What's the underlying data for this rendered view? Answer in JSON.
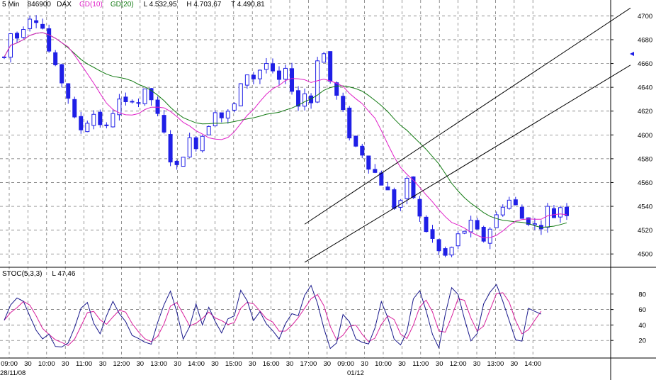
{
  "header": {
    "interval": "5 Min",
    "symbol_code": "846900",
    "symbol_name": "DAX",
    "gd10_label": "GD(10)",
    "gd20_label": "GD(20)",
    "last_label": "L 4.532,95",
    "high_label": "H 4.703,67",
    "low_label": "T 4.490,81"
  },
  "stoch_header": {
    "label": "STOC(5,3,3)",
    "last_label": "L 47,46"
  },
  "colors": {
    "candle": "#1f1fe6",
    "gd10": "#e020c8",
    "gd20": "#137a13",
    "stoch_k": "#1a1a8c",
    "stoch_d": "#d8209c",
    "grid": "#666666",
    "channel": "#000000"
  },
  "date_labels": [
    "28/11/08",
    "01/12"
  ],
  "chart_data": [
    {
      "type": "candlestick",
      "title": "5 Min 846900 DAX",
      "series": [
        {
          "name": "GD(10)",
          "color": "#e020c8"
        },
        {
          "name": "GD(20)",
          "color": "#137a13"
        }
      ],
      "x_tick_labels": [
        "09:00",
        "30",
        "10:00",
        "30",
        "11:00",
        "30",
        "12:00",
        "30",
        "13:00",
        "30",
        "14:00",
        "30",
        "15:00",
        "30",
        "16:00",
        "30",
        "17:00",
        "30",
        "09:00",
        "30",
        "10:00",
        "30",
        "11:00",
        "30",
        "12:00",
        "30",
        "13:00",
        "30",
        "14:00"
      ],
      "y_ticks": [
        4500,
        4520,
        4540,
        4560,
        4580,
        4600,
        4620,
        4640,
        4660,
        4680,
        4700
      ],
      "ylim": [
        4490,
        4705
      ],
      "price_path": [
        [
          0,
          4665
        ],
        [
          1,
          4685
        ],
        [
          2,
          4682
        ],
        [
          3,
          4692
        ],
        [
          4,
          4700
        ],
        [
          5,
          4698
        ],
        [
          6,
          4690
        ],
        [
          7,
          4670
        ],
        [
          8,
          4655
        ],
        [
          9,
          4645
        ],
        [
          10,
          4632
        ],
        [
          11,
          4612
        ],
        [
          12,
          4605
        ],
        [
          13,
          4612
        ],
        [
          14,
          4618
        ],
        [
          15,
          4610
        ],
        [
          16,
          4605
        ],
        [
          17,
          4620
        ],
        [
          18,
          4628
        ],
        [
          19,
          4625
        ],
        [
          20,
          4632
        ],
        [
          21,
          4628
        ],
        [
          22,
          4635
        ],
        [
          23,
          4630
        ],
        [
          24,
          4615
        ],
        [
          25,
          4600
        ],
        [
          26,
          4580
        ],
        [
          27,
          4572
        ],
        [
          28,
          4585
        ],
        [
          29,
          4595
        ],
        [
          30,
          4592
        ],
        [
          31,
          4600
        ],
        [
          32,
          4610
        ],
        [
          33,
          4622
        ],
        [
          34,
          4615
        ],
        [
          35,
          4618
        ],
        [
          36,
          4625
        ],
        [
          37,
          4640
        ],
        [
          38,
          4652
        ],
        [
          39,
          4648
        ],
        [
          40,
          4655
        ],
        [
          41,
          4660
        ],
        [
          42,
          4650
        ],
        [
          43,
          4645
        ],
        [
          44,
          4652
        ],
        [
          45,
          4640
        ],
        [
          46,
          4625
        ],
        [
          47,
          4635
        ],
        [
          48,
          4628
        ],
        [
          49,
          4665
        ],
        [
          50,
          4668
        ],
        [
          51,
          4645
        ],
        [
          52,
          4632
        ],
        [
          53,
          4618
        ],
        [
          54,
          4600
        ],
        [
          55,
          4590
        ],
        [
          56,
          4585
        ],
        [
          57,
          4575
        ],
        [
          58,
          4568
        ],
        [
          59,
          4560
        ],
        [
          60,
          4552
        ],
        [
          61,
          4540
        ],
        [
          62,
          4545
        ],
        [
          63,
          4560
        ],
        [
          64,
          4548
        ],
        [
          65,
          4530
        ],
        [
          66,
          4520
        ],
        [
          67,
          4512
        ],
        [
          68,
          4502
        ],
        [
          69,
          4498
        ],
        [
          70,
          4505
        ],
        [
          71,
          4515
        ],
        [
          72,
          4520
        ],
        [
          73,
          4525
        ],
        [
          74,
          4518
        ],
        [
          75,
          4512
        ],
        [
          76,
          4522
        ],
        [
          77,
          4532
        ],
        [
          78,
          4542
        ],
        [
          79,
          4545
        ],
        [
          80,
          4540
        ],
        [
          81,
          4530
        ],
        [
          82,
          4528
        ],
        [
          83,
          4524
        ],
        [
          84,
          4525
        ],
        [
          85,
          4538
        ],
        [
          86,
          4532
        ],
        [
          87,
          4540
        ],
        [
          88,
          4535
        ]
      ],
      "channel_upper": [
        [
          47,
          4525
        ],
        [
          63,
          4582
        ]
      ],
      "channel_lower": [
        [
          47,
          4493
        ],
        [
          63,
          4545
        ]
      ]
    },
    {
      "type": "line",
      "title": "STOC(5,3,3)",
      "series": [
        {
          "name": "%K",
          "color": "#1a1a8c"
        },
        {
          "name": "%D",
          "color": "#d8209c"
        }
      ],
      "y_ticks": [
        20,
        40,
        60,
        80
      ],
      "ylim": [
        0,
        100
      ],
      "k_path": [
        [
          0,
          50
        ],
        [
          1,
          68
        ],
        [
          2,
          78
        ],
        [
          3,
          72
        ],
        [
          4,
          55
        ],
        [
          5,
          35
        ],
        [
          6,
          22
        ],
        [
          7,
          28
        ],
        [
          8,
          12
        ],
        [
          9,
          8
        ],
        [
          10,
          20
        ],
        [
          11,
          38
        ],
        [
          12,
          65
        ],
        [
          13,
          72
        ],
        [
          14,
          45
        ],
        [
          15,
          30
        ],
        [
          16,
          55
        ],
        [
          17,
          72
        ],
        [
          18,
          58
        ],
        [
          19,
          45
        ],
        [
          20,
          28
        ],
        [
          21,
          20
        ],
        [
          22,
          18
        ],
        [
          23,
          15
        ],
        [
          24,
          40
        ],
        [
          25,
          65
        ],
        [
          26,
          85
        ],
        [
          27,
          55
        ],
        [
          28,
          22
        ],
        [
          29,
          40
        ],
        [
          30,
          65
        ],
        [
          31,
          42
        ],
        [
          32,
          62
        ],
        [
          33,
          45
        ],
        [
          34,
          30
        ],
        [
          35,
          45
        ],
        [
          36,
          55
        ],
        [
          37,
          85
        ],
        [
          38,
          72
        ],
        [
          39,
          48
        ],
        [
          40,
          55
        ],
        [
          41,
          40
        ],
        [
          42,
          35
        ],
        [
          43,
          20
        ],
        [
          44,
          45
        ],
        [
          45,
          55
        ],
        [
          46,
          50
        ],
        [
          47,
          82
        ],
        [
          48,
          92
        ],
        [
          49,
          70
        ],
        [
          50,
          40
        ],
        [
          51,
          10
        ],
        [
          52,
          15
        ],
        [
          53,
          55
        ],
        [
          54,
          48
        ],
        [
          55,
          22
        ],
        [
          56,
          18
        ],
        [
          57,
          15
        ],
        [
          58,
          40
        ],
        [
          59,
          68
        ],
        [
          60,
          50
        ],
        [
          61,
          20
        ],
        [
          62,
          12
        ],
        [
          63,
          35
        ],
        [
          64,
          70
        ],
        [
          65,
          82
        ],
        [
          66,
          55
        ],
        [
          67,
          30
        ],
        [
          68,
          12
        ],
        [
          69,
          55
        ],
        [
          70,
          85
        ],
        [
          71,
          78
        ],
        [
          72,
          45
        ],
        [
          73,
          20
        ],
        [
          74,
          30
        ],
        [
          75,
          65
        ],
        [
          76,
          85
        ],
        [
          77,
          90
        ],
        [
          78,
          70
        ],
        [
          79,
          45
        ],
        [
          80,
          22
        ],
        [
          81,
          18
        ],
        [
          82,
          65
        ],
        [
          83,
          58
        ],
        [
          84,
          55
        ]
      ]
    }
  ]
}
